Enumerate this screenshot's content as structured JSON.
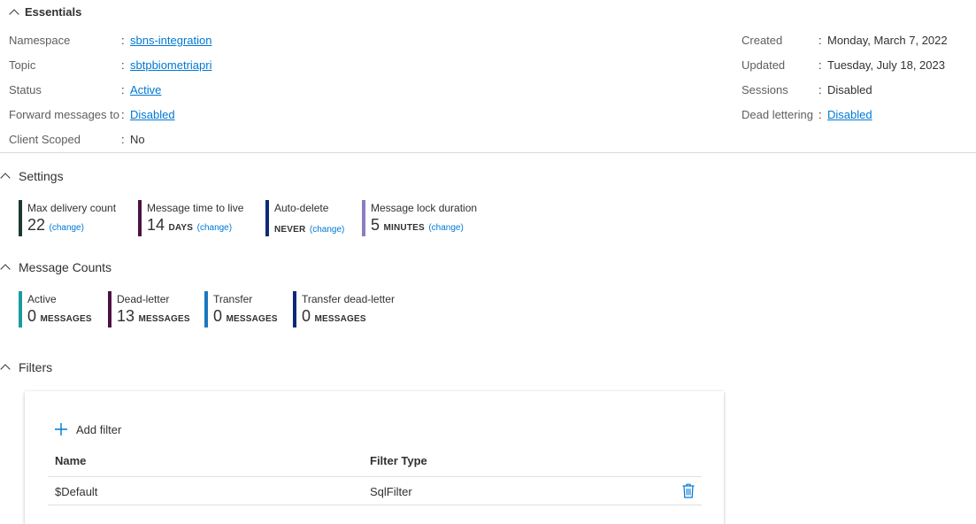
{
  "essentials": {
    "title": "Essentials",
    "left": [
      {
        "label": "Namespace",
        "value": "sbns-integration",
        "link": true
      },
      {
        "label": "Topic",
        "value": "sbtpbiometriapri",
        "link": true
      },
      {
        "label": "Status",
        "value": "Active",
        "link": true
      },
      {
        "label": "Forward messages to",
        "value": "Disabled",
        "link": true
      },
      {
        "label": "Client Scoped",
        "value": "No",
        "link": false
      }
    ],
    "right": [
      {
        "label": "Created",
        "value": "Monday, March 7, 2022",
        "link": false
      },
      {
        "label": "Updated",
        "value": "Tuesday, July 18, 2023",
        "link": false
      },
      {
        "label": "Sessions",
        "value": "Disabled",
        "link": false
      },
      {
        "label": "Dead lettering",
        "value": "Disabled",
        "link": true
      }
    ],
    "colon": ":"
  },
  "settings": {
    "title": "Settings",
    "cards": [
      {
        "label": "Max delivery count",
        "number": "22",
        "unit": "",
        "change": "(change)",
        "color": "#1b3a2f"
      },
      {
        "label": "Message time to live",
        "number": "14",
        "unit": "DAYS",
        "change": "(change)",
        "color": "#4b1242"
      },
      {
        "label": "Auto-delete",
        "number": "",
        "unit": "NEVER",
        "change": "(change)",
        "color": "#0d2a7a"
      },
      {
        "label": "Message lock duration",
        "number": "5",
        "unit": "MINUTES",
        "change": "(change)",
        "color": "#8e7cc3"
      }
    ]
  },
  "message_counts": {
    "title": "Message Counts",
    "cards": [
      {
        "label": "Active",
        "number": "0",
        "unit": "MESSAGES",
        "color": "#1a9ba1"
      },
      {
        "label": "Dead-letter",
        "number": "13",
        "unit": "MESSAGES",
        "color": "#4b1242"
      },
      {
        "label": "Transfer",
        "number": "0",
        "unit": "MESSAGES",
        "color": "#1a78c2"
      },
      {
        "label": "Transfer dead-letter",
        "number": "0",
        "unit": "MESSAGES",
        "color": "#0d2a7a"
      }
    ]
  },
  "filters": {
    "title": "Filters",
    "add_filter": "Add filter",
    "columns": [
      "Name",
      "Filter Type"
    ],
    "rows": [
      {
        "name": "$Default",
        "filter_type": "SqlFilter"
      }
    ]
  },
  "colors": {
    "link": "#0078d4",
    "delete_icon": "#0078d4"
  }
}
